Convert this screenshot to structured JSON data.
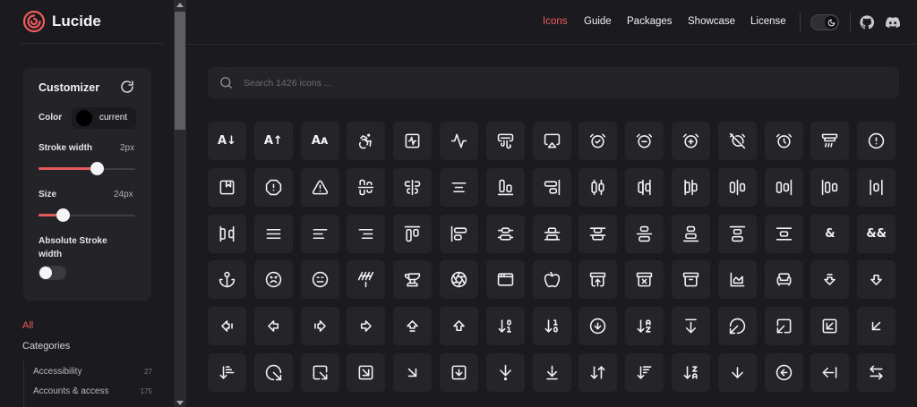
{
  "app": {
    "name": "Lucide"
  },
  "header": {
    "nav": [
      {
        "label": "Icons",
        "active": true
      },
      {
        "label": "Guide",
        "active": false
      },
      {
        "label": "Packages",
        "active": false
      },
      {
        "label": "Showcase",
        "active": false
      },
      {
        "label": "License",
        "active": false
      }
    ],
    "theme": "dark",
    "icons": [
      "github-icon",
      "discord-icon"
    ]
  },
  "customizer": {
    "title": "Customizer",
    "color": {
      "label": "Color",
      "value": "current"
    },
    "stroke_width": {
      "label": "Stroke width",
      "value": "2px",
      "fraction": 0.6
    },
    "size": {
      "label": "Size",
      "value": "24px",
      "fraction": 0.25
    },
    "absolute_stroke": {
      "label": "Absolute Stroke width",
      "enabled": false
    }
  },
  "categories": {
    "all_label": "All",
    "heading": "Categories",
    "items": [
      {
        "name": "Accessibility",
        "count": "27"
      },
      {
        "name": "Accounts & access",
        "count": "175"
      }
    ]
  },
  "search": {
    "placeholder": "Search 1426 icons ..."
  },
  "colors": {
    "accent": "#f15b5b",
    "background": "#1b1b1f",
    "tile": "#242429",
    "icon_stroke": "#f2f2f2"
  },
  "icon_grid": [
    [
      "a-arrow-down",
      "a-arrow-up",
      "a-large-small",
      "accessibility",
      "activity-square",
      "activity",
      "air-vent",
      "airplay",
      "alarm-check",
      "alarm-clock-minus",
      "alarm-clock-plus",
      "alarm-clock-off",
      "alarm-clock",
      "alarm-smoke",
      "alert-circle"
    ],
    [
      "album",
      "alert-octagon",
      "alert-triangle",
      "align-center-horizontal",
      "align-center-vertical",
      "align-center",
      "align-end-horizontal",
      "align-end-vertical",
      "align-horizontal-distribute-center",
      "align-horizontal-distribute-end",
      "align-horizontal-distribute-start",
      "align-horizontal-justify-center",
      "align-horizontal-justify-end",
      "align-horizontal-justify-start",
      "align-horizontal-space-around"
    ],
    [
      "align-horizontal-space-between",
      "align-justify",
      "align-left",
      "align-right",
      "align-start-horizontal",
      "align-start-vertical",
      "align-vertical-distribute-center",
      "align-vertical-distribute-end",
      "align-vertical-distribute-start",
      "align-vertical-justify-center",
      "align-vertical-justify-end",
      "align-vertical-justify-start",
      "align-vertical-space-around",
      "ampersand",
      "ampersands"
    ],
    [
      "anchor",
      "angry",
      "annoyed",
      "antenna",
      "anvil",
      "aperture",
      "app-window",
      "apple",
      "archive-restore",
      "archive-x",
      "archive",
      "area-chart",
      "armchair",
      "arrow-big-down-dash",
      "arrow-big-down"
    ],
    [
      "arrow-big-left-dash",
      "arrow-big-left",
      "arrow-big-right-dash",
      "arrow-big-right",
      "arrow-big-up-dash",
      "arrow-big-up",
      "arrow-down-0-1",
      "arrow-down-1-0",
      "arrow-down-circle",
      "arrow-down-a-z",
      "arrow-down-from-line",
      "arrow-down-left-from-circle",
      "arrow-down-left-from-square",
      "arrow-down-left-square",
      "arrow-down-left"
    ],
    [
      "arrow-down-narrow-wide",
      "arrow-down-right-from-circle",
      "arrow-down-right-from-square",
      "arrow-down-right-square",
      "arrow-down-right",
      "arrow-down-square",
      "arrow-down-to-dot",
      "arrow-down-to-line",
      "arrow-down-up",
      "arrow-down-wide-narrow",
      "arrow-down-z-a",
      "arrow-down",
      "arrow-left-circle",
      "arrow-left-from-line",
      "arrow-left-right"
    ]
  ]
}
